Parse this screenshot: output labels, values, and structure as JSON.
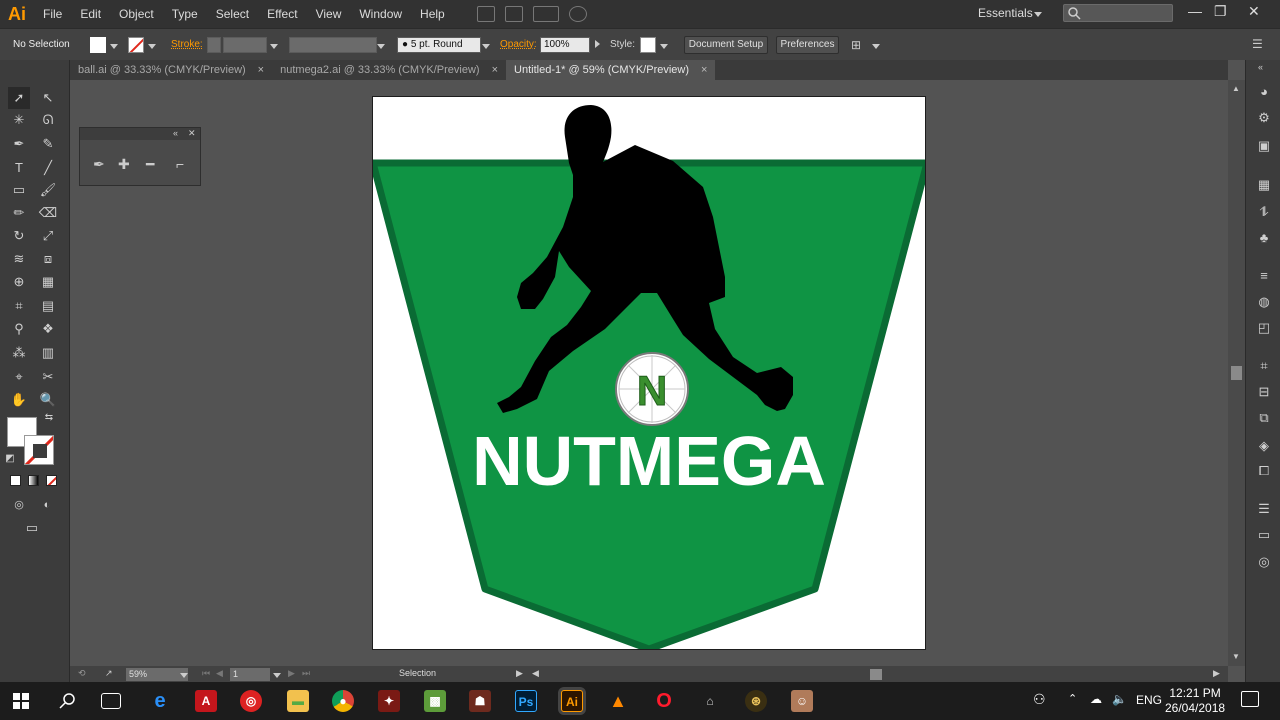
{
  "app": {
    "logo": "Ai"
  },
  "menu": [
    "File",
    "Edit",
    "Object",
    "Type",
    "Select",
    "Effect",
    "View",
    "Window",
    "Help"
  ],
  "workspace": {
    "label": "Essentials"
  },
  "control": {
    "selection": "No Selection",
    "stroke_label": "Stroke:",
    "brush": "5 pt. Round",
    "opacity_label": "Opacity:",
    "opacity_value": "100%",
    "style_label": "Style:",
    "document_setup": "Document Setup",
    "preferences": "Preferences"
  },
  "tabs": [
    {
      "label": "ball.ai @ 33.33% (CMYK/Preview)",
      "close": "×"
    },
    {
      "label": "nutmega2.ai @ 33.33% (CMYK/Preview)",
      "close": "×"
    },
    {
      "label": "Untitled-1* @ 59% (CMYK/Preview)",
      "close": "×"
    }
  ],
  "artwork": {
    "title": "NUTMEGA",
    "ball_letter": "N",
    "colors": {
      "shield": "#0f9444",
      "shield_border": "#0a6b34",
      "silhouette": "#000000"
    }
  },
  "status": {
    "zoom": "59%",
    "page": "1",
    "tool": "Selection"
  },
  "taskbar": {
    "time": "12:21 PM",
    "date": "26/04/2018",
    "lang": "ENG"
  },
  "colors": {
    "accent": "#ff9a00",
    "chrome_dark": "#323232",
    "canvas": "#535353"
  }
}
